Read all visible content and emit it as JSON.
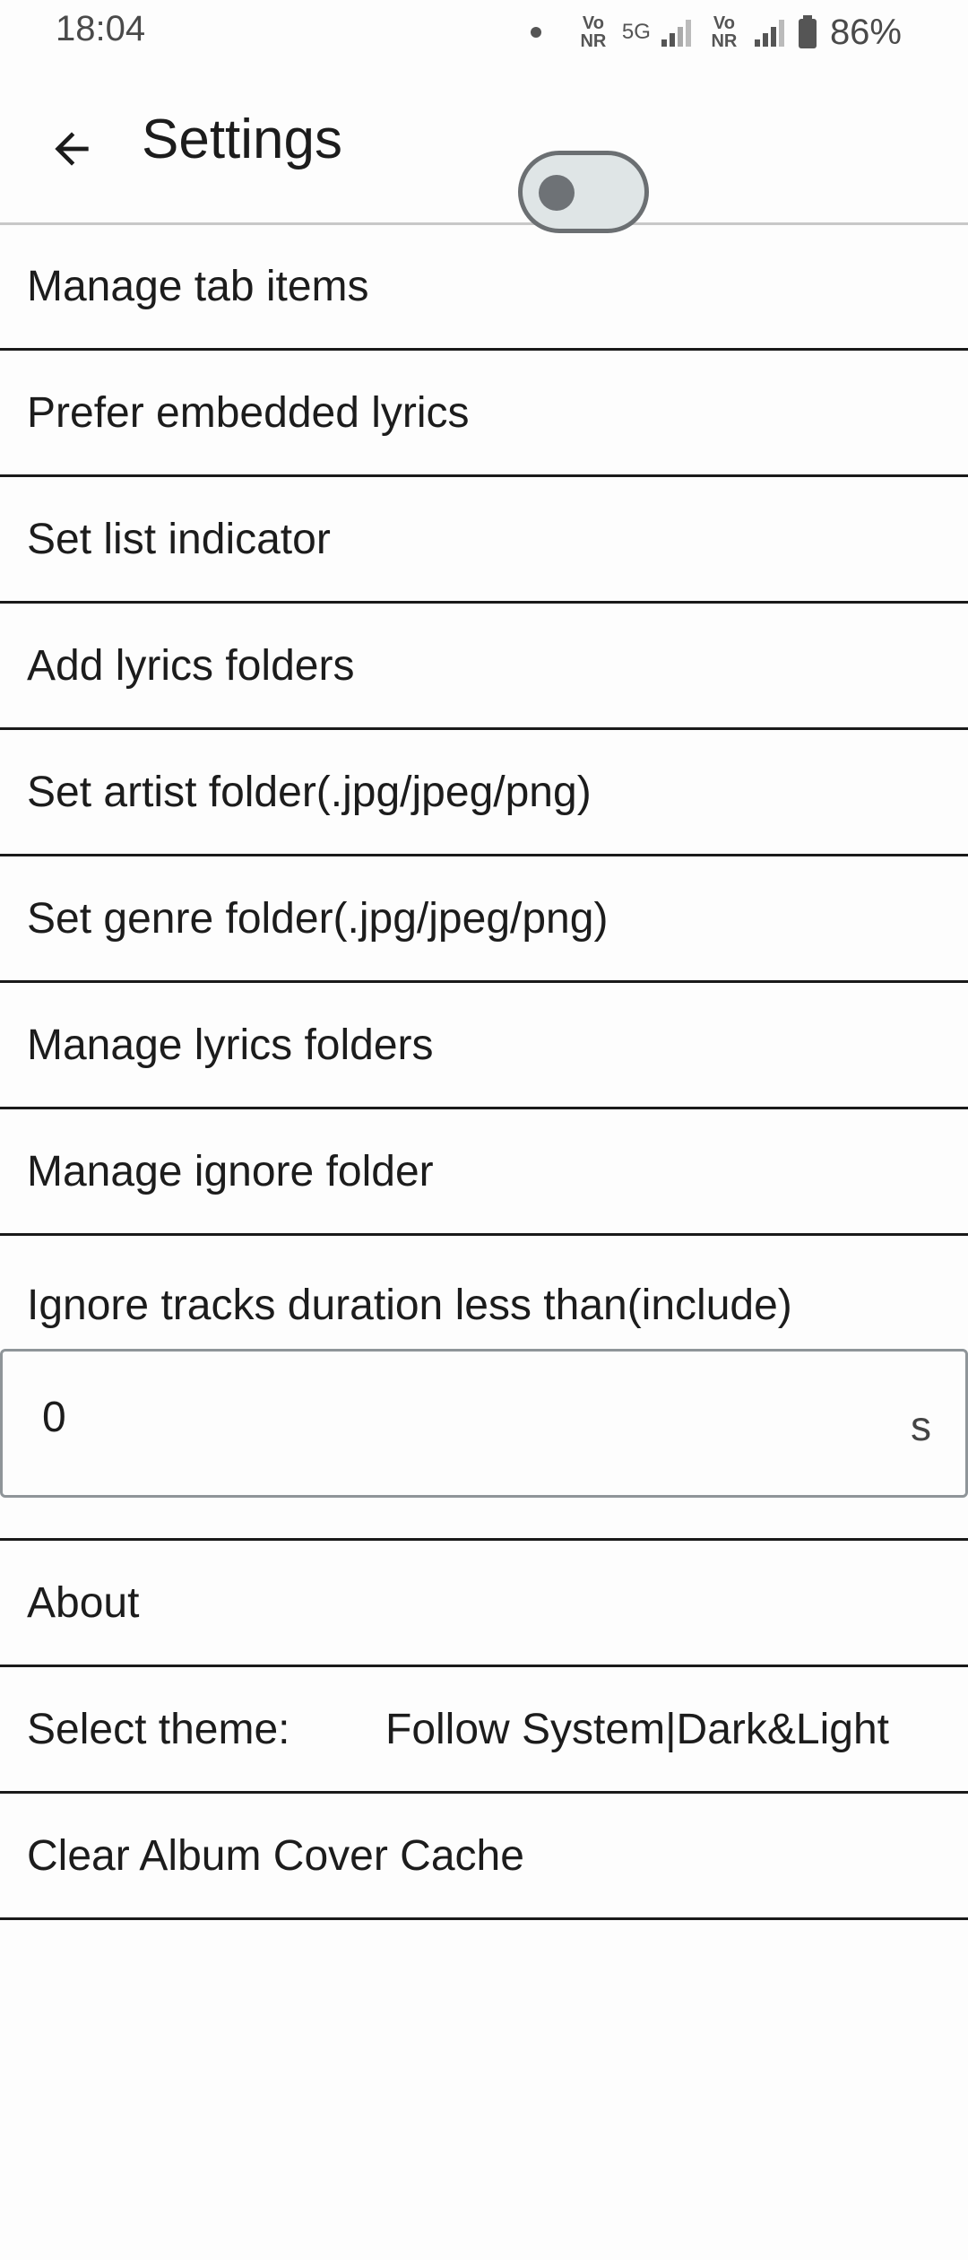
{
  "status_bar": {
    "time": "18:04",
    "sim1_tag": "Vo NR",
    "network": "5G",
    "sim2_tag": "Vo NR",
    "battery": "86%"
  },
  "header": {
    "title": "Settings",
    "back_icon": "arrow-left-icon"
  },
  "settings": {
    "manage_tabs": "Manage tab items",
    "prefer_embedded_lyrics": "Prefer embedded lyrics",
    "prefer_embedded_lyrics_on": false,
    "set_list_indicator": "Set list indicator",
    "add_lyrics_folders": "Add lyrics folders",
    "set_artist_folder": "Set artist folder(.jpg/jpeg/png)",
    "set_genre_folder": "Set genre folder(.jpg/jpeg/png)",
    "manage_lyrics_folders": "Manage lyrics folders",
    "manage_ignore_folder": "Manage ignore folder",
    "ignore_duration_label": "Ignore tracks duration less than(include)",
    "ignore_duration_value": "0",
    "ignore_duration_unit": "s",
    "about": "About",
    "select_theme_label": "Select theme:",
    "select_theme_value": "Follow System|Dark&Light",
    "clear_cache": "Clear Album Cover Cache"
  },
  "colors": {
    "background": "#fdfdfd",
    "toggle_track": "#dfe5e6",
    "toggle_knob": "#6e7276",
    "divider": "#1a1a1a"
  }
}
